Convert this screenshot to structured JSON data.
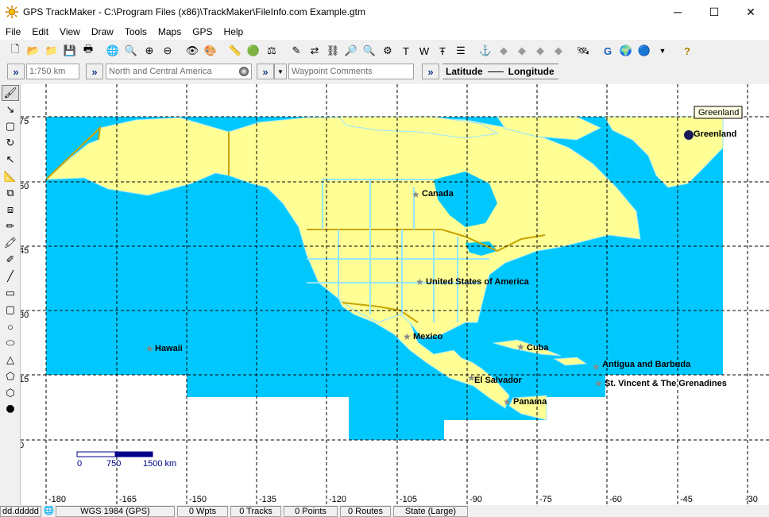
{
  "window": {
    "title": "GPS TrackMaker - C:\\Program Files (x86)\\TrackMaker\\FileInfo.com Example.gtm",
    "minimize": "─",
    "maximize": "☐",
    "close": "✕"
  },
  "menu": [
    "File",
    "Edit",
    "View",
    "Draw",
    "Tools",
    "Maps",
    "GPS",
    "Help"
  ],
  "toolbar2": {
    "scale_value": "1:750 km",
    "map_name": "North and Central America",
    "waypoint_comments": "Waypoint Comments",
    "latitude_label": "Latitude",
    "longitude_label": "Longitude"
  },
  "map": {
    "tooltip": "Greenland",
    "lat_labels": [
      "75",
      "60",
      "45",
      "30",
      "15",
      "0"
    ],
    "lon_labels": [
      "-180",
      "-165",
      "-150",
      "-135",
      "-120",
      "-105",
      "-90",
      "-75",
      "-60",
      "-45",
      "-30"
    ],
    "waypoints": [
      {
        "name": "Greenland"
      },
      {
        "name": "Canada"
      },
      {
        "name": "United States of America"
      },
      {
        "name": "Mexico"
      },
      {
        "name": "Hawaii"
      },
      {
        "name": "Cuba"
      },
      {
        "name": "Antigua and Barbuda"
      },
      {
        "name": "St. Vincent & The Grenadines"
      },
      {
        "name": "El Salvador"
      },
      {
        "name": "Panama"
      }
    ],
    "scale_bar": {
      "labels": [
        "0",
        "750",
        "1500 km"
      ]
    },
    "colors": {
      "ocean": "#00c8ff",
      "land": "#ffff96",
      "border": "#99e6ff",
      "grid": "#000000"
    }
  },
  "status": {
    "coord_format": "dd.ddddd",
    "datum": "WGS 1984 (GPS)",
    "waypoints": "0 Wpts",
    "tracks": "0 Tracks",
    "points": "0 Points",
    "routes": "0 Routes",
    "state": "State (Large)"
  }
}
